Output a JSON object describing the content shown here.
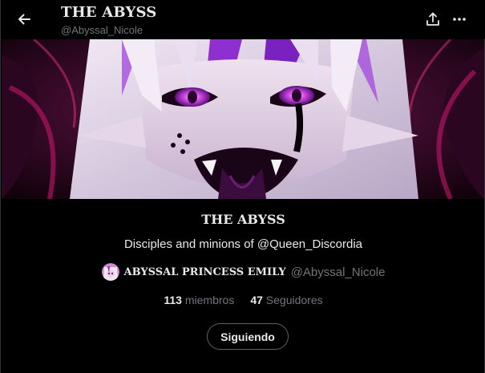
{
  "header": {
    "title": "THE ABYSS",
    "handle": "@Abyssal_Nicole",
    "back_icon": "arrow-left-icon",
    "share_icon": "share-icon",
    "more_icon": "more-horizontal-icon"
  },
  "banner": {
    "alt": "Anime artwork of a pale-haired demon girl with purple eyes and pointed ears"
  },
  "list": {
    "name": "THE ABYSS",
    "description": "Disciples and minions of @Queen_Discordia",
    "owner_name": "ABYSSAL PRINCESS EMILY",
    "owner_handle": "@Abyssal_Nicole",
    "members_count": "113",
    "members_label": "miembros",
    "followers_count": "47",
    "followers_label": "Seguidores",
    "follow_button": "Siguiendo"
  },
  "colors": {
    "background": "#000000",
    "text": "#e7e9ea",
    "secondary_text": "#71767b",
    "button_border": "#536471",
    "banner_accent": "#9b30d9"
  }
}
